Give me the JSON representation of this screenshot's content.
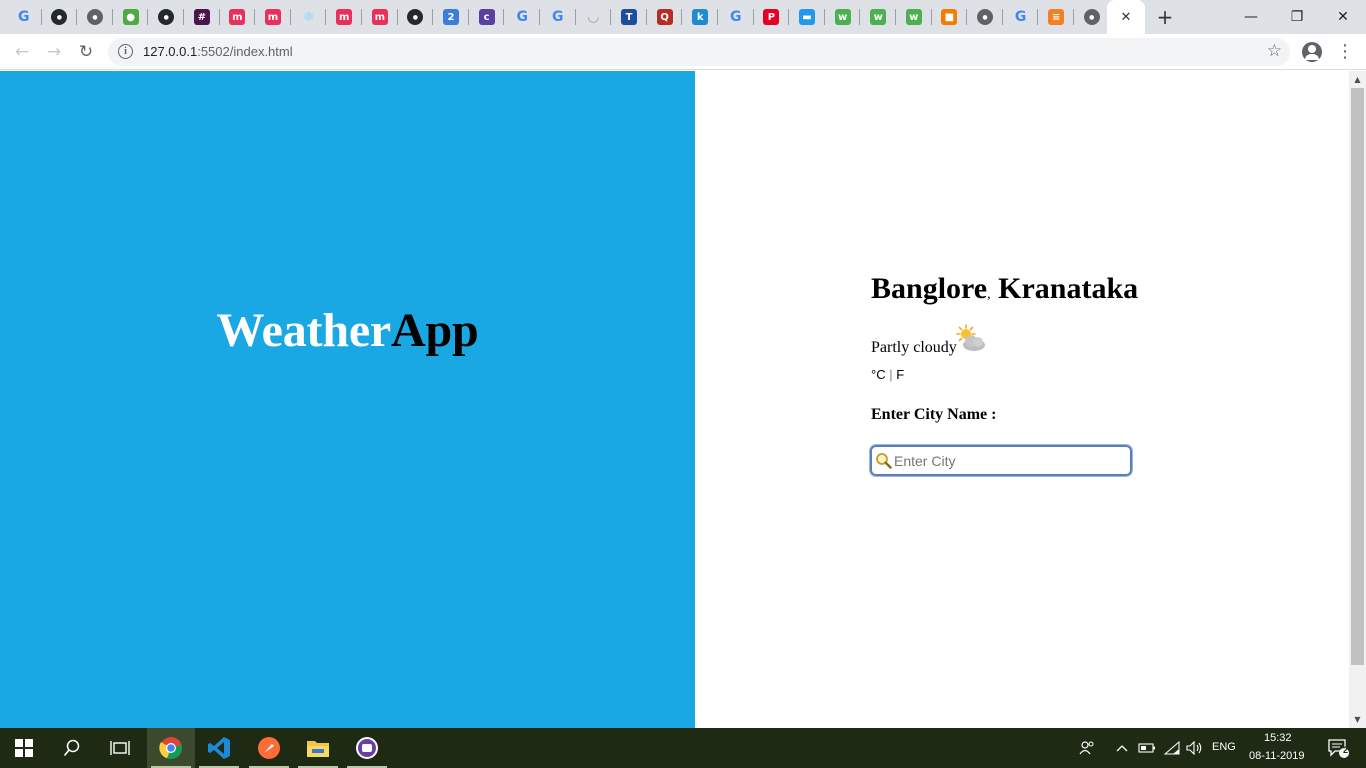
{
  "browser": {
    "tabs": [
      {
        "icon": "google-icon",
        "color": "#4285f4",
        "glyph": "G"
      },
      {
        "icon": "github-icon",
        "color": "#24292e",
        "glyph": "●"
      },
      {
        "icon": "globe-icon",
        "color": "#5f6368",
        "glyph": "●"
      },
      {
        "icon": "mongodb-icon",
        "color": "#4faa41",
        "glyph": "●"
      },
      {
        "icon": "github-icon",
        "color": "#24292e",
        "glyph": "●"
      },
      {
        "icon": "slack-icon",
        "color": "#4a154b",
        "glyph": "#"
      },
      {
        "icon": "medium-icon",
        "color": "#e8305a",
        "glyph": "m"
      },
      {
        "icon": "medium-icon",
        "color": "#e8305a",
        "glyph": "m"
      },
      {
        "icon": "react-icon",
        "color": "#61dafb",
        "glyph": "⚛"
      },
      {
        "icon": "medium-icon",
        "color": "#e8305a",
        "glyph": "m"
      },
      {
        "icon": "medium-icon",
        "color": "#e8305a",
        "glyph": "m"
      },
      {
        "icon": "github-icon",
        "color": "#24292e",
        "glyph": "●"
      },
      {
        "icon": "number-2-icon",
        "color": "#3b7dd8",
        "glyph": "2"
      },
      {
        "icon": "colorlib-icon",
        "color": "#5a3fa0",
        "glyph": "c"
      },
      {
        "icon": "google-icon",
        "color": "#4285f4",
        "glyph": "G"
      },
      {
        "icon": "google-icon",
        "color": "#4285f4",
        "glyph": "G"
      },
      {
        "icon": "loading-icon",
        "color": "#9aa0a6",
        "glyph": "◡"
      },
      {
        "icon": "tata-icon",
        "color": "#1c4e9b",
        "glyph": "T"
      },
      {
        "icon": "quora-icon",
        "color": "#b92b27",
        "glyph": "Q"
      },
      {
        "icon": "k-icon",
        "color": "#1f8ad0",
        "glyph": "k"
      },
      {
        "icon": "google-icon",
        "color": "#4285f4",
        "glyph": "G"
      },
      {
        "icon": "pinterest-icon",
        "color": "#e60023",
        "glyph": "P"
      },
      {
        "icon": "docker-icon",
        "color": "#2496ed",
        "glyph": "▬"
      },
      {
        "icon": "w3schools-icon",
        "color": "#4caf50",
        "glyph": "w"
      },
      {
        "icon": "w3schools-icon",
        "color": "#4caf50",
        "glyph": "w"
      },
      {
        "icon": "w3schools-icon",
        "color": "#4caf50",
        "glyph": "w"
      },
      {
        "icon": "package-icon",
        "color": "#f57c00",
        "glyph": "■"
      },
      {
        "icon": "globe-icon",
        "color": "#5f6368",
        "glyph": "●"
      },
      {
        "icon": "google-icon",
        "color": "#4285f4",
        "glyph": "G"
      },
      {
        "icon": "stackoverflow-icon",
        "color": "#f48024",
        "glyph": "≡"
      },
      {
        "icon": "globe-icon",
        "color": "#5f6368",
        "glyph": "●"
      }
    ],
    "active_tab_close": "✕",
    "new_tab": "+",
    "window_controls": {
      "minimize": "—",
      "restore": "❐",
      "close": "✕"
    },
    "nav": {
      "back": "←",
      "forward": "→",
      "reload": "↻"
    },
    "url": {
      "host": "127.0.0.1",
      "port_path": ":5502/index.html"
    },
    "star": "☆",
    "menu": "⋮"
  },
  "page": {
    "title_part1": "Weather",
    "title_part2": "App",
    "city": "Banglore",
    "separator": ",",
    "state": "Kranataka",
    "condition": "Partly cloudy",
    "unit_c": "°C",
    "unit_sep": "|",
    "unit_f": "F",
    "city_label": "Enter City Name :",
    "search_placeholder": "Enter City",
    "colors": {
      "left_bg": "#19a8e3",
      "title_white": "#ffffff",
      "title_black": "#000000"
    }
  },
  "taskbar": {
    "apps": [
      "windows-start-icon",
      "search-icon",
      "task-view-icon",
      "chrome-icon",
      "vscode-icon",
      "postman-icon",
      "file-explorer-icon",
      "emulator-icon"
    ],
    "language": "ENG",
    "time": "15:32",
    "date": "08-11-2019",
    "notifications": "2"
  }
}
